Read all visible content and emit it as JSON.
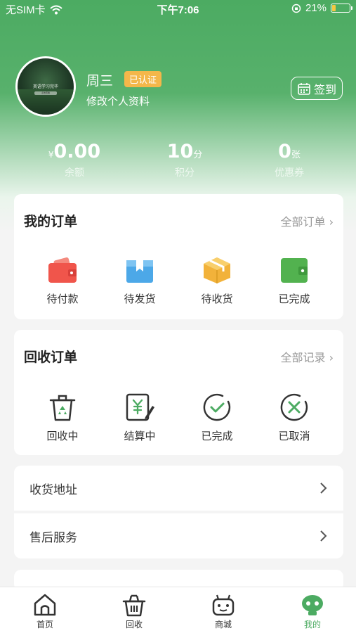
{
  "status_bar": {
    "carrier": "无SIM卡",
    "time": "下午7:06",
    "battery": "21%",
    "battery_level": 0.21
  },
  "profile": {
    "avatar_text": "英语学习完毕",
    "avatar_subtext": "点击查看",
    "name": "周三",
    "badge": "已认证",
    "edit": "修改个人资料",
    "checkin": "签到"
  },
  "stats": [
    {
      "prefix": "¥",
      "value": "0.00",
      "unit": "",
      "label": "余额"
    },
    {
      "prefix": "",
      "value": "10",
      "unit": "分",
      "label": "积分"
    },
    {
      "prefix": "",
      "value": "0",
      "unit": "张",
      "label": "优惠券"
    }
  ],
  "my_orders": {
    "title": "我的订单",
    "link": "全部订单",
    "items": [
      {
        "label": "待付款",
        "icon": "wallet-icon",
        "color": "#f0554b"
      },
      {
        "label": "待发货",
        "icon": "box-ship-icon",
        "color": "#4ca8e8"
      },
      {
        "label": "待收货",
        "icon": "package-icon",
        "color": "#f2b23a"
      },
      {
        "label": "已完成",
        "icon": "wallet-done-icon",
        "color": "#52b24f"
      }
    ]
  },
  "recycle_orders": {
    "title": "回收订单",
    "link": "全部记录",
    "items": [
      {
        "label": "回收中",
        "icon": "recycle-bin-icon"
      },
      {
        "label": "结算中",
        "icon": "settlement-icon"
      },
      {
        "label": "已完成",
        "icon": "check-circle-icon"
      },
      {
        "label": "已取消",
        "icon": "x-circle-icon"
      }
    ]
  },
  "menu": [
    {
      "label": "收货地址"
    },
    {
      "label": "售后服务"
    }
  ],
  "tabs": [
    {
      "label": "首页",
      "icon": "home-icon"
    },
    {
      "label": "回收",
      "icon": "basket-icon"
    },
    {
      "label": "商城",
      "icon": "robot-icon"
    },
    {
      "label": "我的",
      "icon": "profile-face-icon"
    }
  ],
  "colors": {
    "accent": "#4cab62",
    "badge": "#f4b74a"
  }
}
